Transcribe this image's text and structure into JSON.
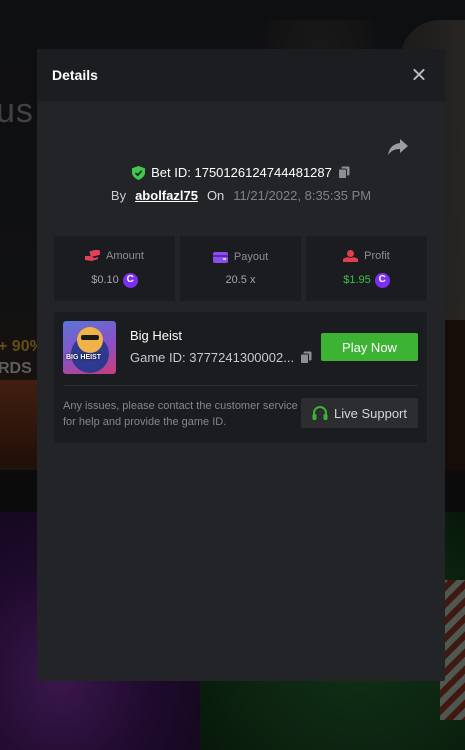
{
  "background": {
    "bonus_text": "us",
    "promo_percent": "+ 90%",
    "promo_rewards": "RDS"
  },
  "modal": {
    "title": "Details",
    "bet": {
      "id_label": "Bet ID: 1750126124744481287",
      "by_label": "By",
      "username": "abolfazl75",
      "on_label": "On",
      "datetime": "11/21/2022, 8:35:35 PM"
    },
    "stats": {
      "amount": {
        "label": "Amount",
        "value": "$0.10",
        "icon": "money-hand-icon",
        "color": "#e0405a"
      },
      "payout": {
        "label": "Payout",
        "value": "20.5 x",
        "icon": "wallet-icon",
        "color": "#8b4cf0"
      },
      "profit": {
        "label": "Profit",
        "value": "$1.95",
        "icon": "profit-icon",
        "color": "#e0404a",
        "value_color": "#39c24a"
      }
    },
    "coin_symbol": "C",
    "game": {
      "name": "Big Heist",
      "id_label": "Game ID: 3777241300002...",
      "thumb_text": "BIG HEIST",
      "play_label": "Play Now"
    },
    "support": {
      "note": "Any issues, please contact the customer service for help and provide the game ID.",
      "button_label": "Live Support"
    }
  },
  "colors": {
    "accent_green": "#3cb332",
    "shield_green": "#3ec94b",
    "coin_purple": "#7b2ff2"
  }
}
